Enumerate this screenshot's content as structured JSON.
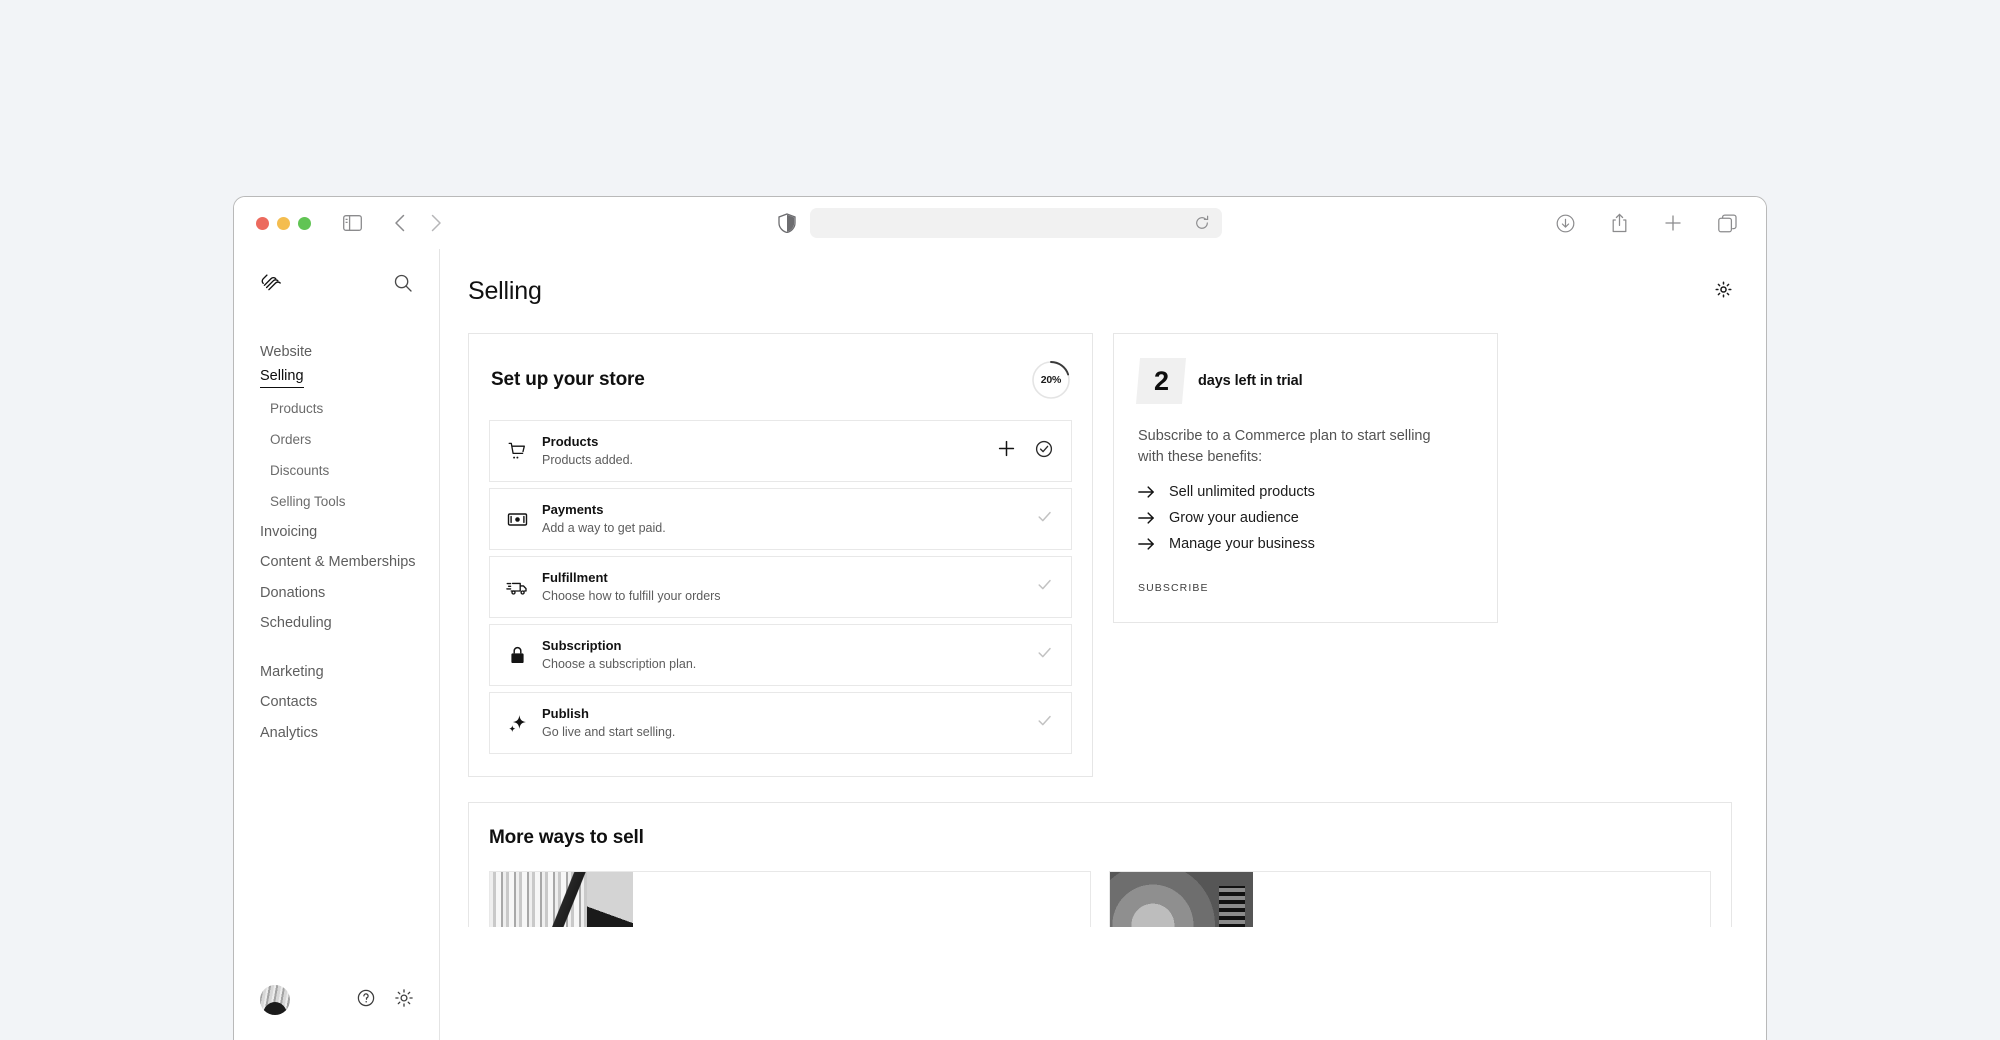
{
  "browser": {
    "window_controls": [
      "close",
      "minimize",
      "maximize"
    ],
    "sidebar_toggle_icon": "sidebar-toggle-icon",
    "back_icon": "chevron-left-icon",
    "forward_icon": "chevron-right-icon",
    "shield_icon": "privacy-shield-icon",
    "url_value": "",
    "url_placeholder": "",
    "reload_icon": "reload-icon",
    "right_icons": [
      "downloads-icon",
      "share-icon",
      "new-tab-icon",
      "tab-overview-icon"
    ]
  },
  "sidebar": {
    "logo": "squarespace-logo",
    "search_icon": "search-icon",
    "items": [
      {
        "label": "Website",
        "type": "top",
        "active": false
      },
      {
        "label": "Selling",
        "type": "top",
        "active": true
      },
      {
        "label": "Products",
        "type": "sub",
        "active": false
      },
      {
        "label": "Orders",
        "type": "sub",
        "active": false
      },
      {
        "label": "Discounts",
        "type": "sub",
        "active": false
      },
      {
        "label": "Selling Tools",
        "type": "sub",
        "active": false
      },
      {
        "label": "Invoicing",
        "type": "top",
        "active": false
      },
      {
        "label": "Content & Memberships",
        "type": "top",
        "active": false
      },
      {
        "label": "Donations",
        "type": "top",
        "active": false
      },
      {
        "label": "Scheduling",
        "type": "top",
        "active": false
      },
      {
        "label": "Marketing",
        "type": "top",
        "active": false
      },
      {
        "label": "Contacts",
        "type": "top",
        "active": false
      },
      {
        "label": "Analytics",
        "type": "top",
        "active": false
      }
    ],
    "footer": {
      "avatar": "user-avatar",
      "help_icon": "help-icon",
      "settings_icon": "gear-icon"
    }
  },
  "header": {
    "title": "Selling",
    "settings_icon": "gear-icon"
  },
  "setup": {
    "title": "Set up your store",
    "progress_percent": 20,
    "progress_label": "20%",
    "tasks": [
      {
        "icon": "shopping-cart-icon",
        "title": "Products",
        "desc": "Products added.",
        "has_add": true,
        "add_icon": "plus-icon",
        "status": "done",
        "status_icon": "check-circle-icon"
      },
      {
        "icon": "payment-card-icon",
        "title": "Payments",
        "desc": "Add a way to get paid.",
        "has_add": false,
        "add_icon": "",
        "status": "todo",
        "status_icon": "check-icon"
      },
      {
        "icon": "delivery-truck-icon",
        "title": "Fulfillment",
        "desc": "Choose how to fulfill your orders",
        "has_add": false,
        "add_icon": "",
        "status": "todo",
        "status_icon": "check-icon"
      },
      {
        "icon": "lock-icon",
        "title": "Subscription",
        "desc": "Choose a subscription plan.",
        "has_add": false,
        "add_icon": "",
        "status": "todo",
        "status_icon": "check-icon"
      },
      {
        "icon": "sparkle-icon",
        "title": "Publish",
        "desc": "Go live and start selling.",
        "has_add": false,
        "add_icon": "",
        "status": "todo",
        "status_icon": "check-icon"
      }
    ]
  },
  "trial": {
    "days": "2",
    "days_label": "days left in trial",
    "description": "Subscribe to a Commerce plan to start selling with these benefits:",
    "benefits": [
      "Sell unlimited products",
      "Grow your audience",
      "Manage your business"
    ],
    "cta": "SUBSCRIBE"
  },
  "more_ways": {
    "title": "More ways to sell",
    "items": [
      {
        "thumb": "storefront-photo"
      },
      {
        "thumb": "product-photo"
      }
    ]
  },
  "colors": {
    "accent": "#0d0d0d",
    "page_bg": "#f2f4f7",
    "card_border": "#e6e6e6",
    "muted_text": "#5c5c5c",
    "check_done": "#2b2b2b",
    "check_todo": "#c2c2c2"
  }
}
